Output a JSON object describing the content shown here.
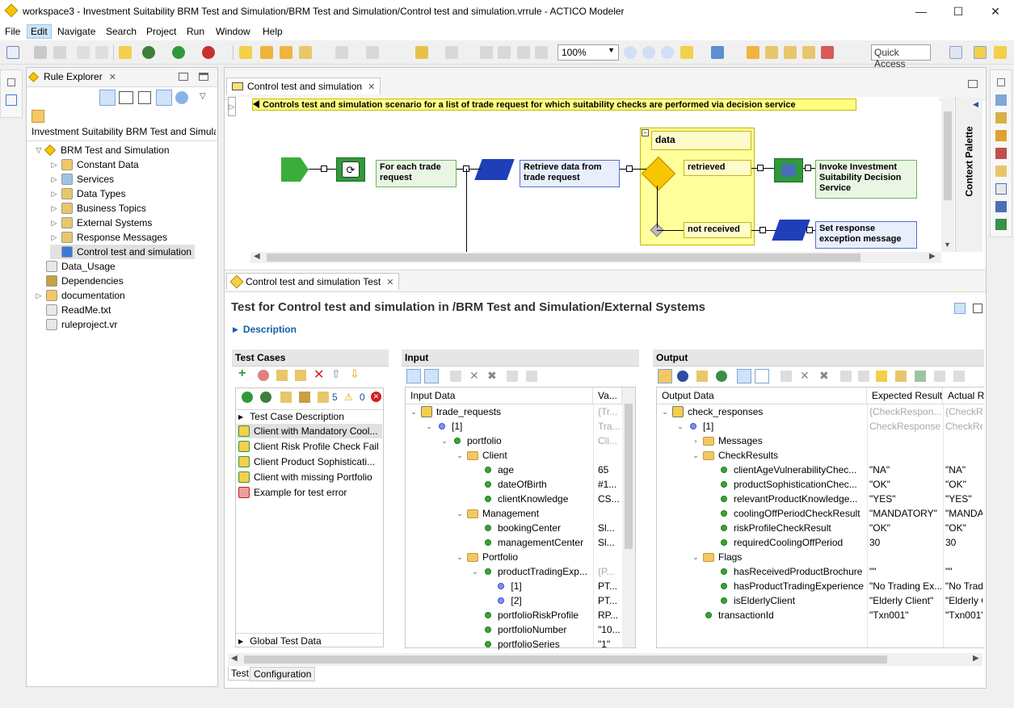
{
  "window": {
    "title": "workspace3 - Investment Suitability BRM Test and Simulation/BRM Test and Simulation/Control test and simulation.vrrule - ACTICO Modeler",
    "controls": [
      "—",
      "☐",
      "✕"
    ]
  },
  "menu": [
    "File",
    "Edit",
    "Navigate",
    "Search",
    "Project",
    "Run",
    "Window",
    "Help"
  ],
  "toolbar": {
    "zoom": "100%",
    "quick_access": "Quick Access"
  },
  "explorer": {
    "tab": "Rule Explorer",
    "project": "Investment Suitability BRM Test and Simula",
    "items": [
      {
        "label": "BRM Test and Simulation",
        "level": 0
      },
      {
        "label": "Constant Data",
        "level": 1
      },
      {
        "label": "Services",
        "level": 1
      },
      {
        "label": "Data Types",
        "level": 1
      },
      {
        "label": "Business Topics",
        "level": 1
      },
      {
        "label": "External Systems",
        "level": 1
      },
      {
        "label": "Response Messages",
        "level": 1
      },
      {
        "label": "Control test and simulation",
        "level": 1
      },
      {
        "label": "Data_Usage",
        "level": 0
      },
      {
        "label": "Dependencies",
        "level": 0
      },
      {
        "label": "documentation",
        "level": 0
      },
      {
        "label": "ReadMe.txt",
        "level": 0
      },
      {
        "label": "ruleproject.vr",
        "level": 0
      }
    ]
  },
  "editor": {
    "tab": "Control test and simulation",
    "banner": "Controls test and simulation scenario for a list of trade request for which suitability checks are performed via decision service",
    "nodes": {
      "loop": "For each trade request",
      "retrieve": "Retrieve data from trade request",
      "data": "data",
      "retrieved": "retrieved",
      "not_received": "not received",
      "invoke": "Invoke Investment Suitability Decision Service",
      "set_response": "Set response exception message"
    },
    "palette": "Context Palette"
  },
  "test": {
    "tab": "Control test and simulation Test",
    "heading": "Test for Control test and simulation in /BRM Test and Simulation/External Systems",
    "description": "Description",
    "test_cases": {
      "header": "Test Cases",
      "pass_count": "5",
      "warn_count": "0",
      "col": "Test Case Description",
      "items": [
        "Client with Mandatory Cool...",
        "Client Risk Profile Check Fail",
        "Client Product Sophisticati...",
        "Client with missing Portfolio",
        "Example for test error"
      ],
      "global": "Global Test Data"
    },
    "input": {
      "header": "Input",
      "col1": "Input Data",
      "col2": "Va...",
      "rows": [
        {
          "label": "trade_requests",
          "value": "{Tr...",
          "indent": 0,
          "gray": true
        },
        {
          "label": "[1]",
          "value": "Tra...",
          "indent": 1,
          "gray": true
        },
        {
          "label": "portfolio",
          "value": "Cli...",
          "indent": 2,
          "gray": true
        },
        {
          "label": "Client",
          "value": "",
          "indent": 3
        },
        {
          "label": "age",
          "value": "65",
          "indent": 4
        },
        {
          "label": "dateOfBirth",
          "value": "#1...",
          "indent": 4
        },
        {
          "label": "clientKnowledge",
          "value": "CS...",
          "indent": 4
        },
        {
          "label": "Management",
          "value": "",
          "indent": 3
        },
        {
          "label": "bookingCenter",
          "value": "Sl...",
          "indent": 4
        },
        {
          "label": "managementCenter",
          "value": "Sl...",
          "indent": 4
        },
        {
          "label": "Portfolio",
          "value": "",
          "indent": 3
        },
        {
          "label": "productTradingExp...",
          "value": "{P...",
          "indent": 4,
          "gray": true
        },
        {
          "label": "[1]",
          "value": "PT...",
          "indent": 5
        },
        {
          "label": "[2]",
          "value": "PT...",
          "indent": 5
        },
        {
          "label": "portfolioRiskProfile",
          "value": "RP...",
          "indent": 4
        },
        {
          "label": "portfolioNumber",
          "value": "\"10...",
          "indent": 4
        },
        {
          "label": "portfolioSeries",
          "value": "\"1\"",
          "indent": 4
        }
      ]
    },
    "output": {
      "header": "Output",
      "col1": "Output Data",
      "col2": "Expected Result",
      "col3": "Actual R",
      "rows": [
        {
          "label": "check_responses",
          "expected": "{CheckRespon...",
          "actual": "{CheckRe",
          "indent": 0,
          "gray": true
        },
        {
          "label": "[1]",
          "expected": "CheckResponse",
          "actual": "CheckRe",
          "indent": 1,
          "gray": true
        },
        {
          "label": "Messages",
          "expected": "",
          "actual": "",
          "indent": 2
        },
        {
          "label": "CheckResults",
          "expected": "",
          "actual": "",
          "indent": 2
        },
        {
          "label": "clientAgeVulnerabilityChec...",
          "expected": "\"NA\"",
          "actual": "\"NA\"",
          "indent": 3
        },
        {
          "label": "productSophisticationChec...",
          "expected": "\"OK\"",
          "actual": "\"OK\"",
          "indent": 3
        },
        {
          "label": "relevantProductKnowledge...",
          "expected": "\"YES\"",
          "actual": "\"YES\"",
          "indent": 3
        },
        {
          "label": "coolingOffPeriodCheckResult",
          "expected": "\"MANDATORY\"",
          "actual": "\"MANDA",
          "indent": 3
        },
        {
          "label": "riskProfileCheckResult",
          "expected": "\"OK\"",
          "actual": "\"OK\"",
          "indent": 3
        },
        {
          "label": "requiredCoolingOffPeriod",
          "expected": "30",
          "actual": "30",
          "indent": 3
        },
        {
          "label": "Flags",
          "expected": "",
          "actual": "",
          "indent": 2
        },
        {
          "label": "hasReceivedProductBrochure",
          "expected": "\"\"",
          "actual": "\"\"",
          "indent": 3
        },
        {
          "label": "hasProductTradingExperience",
          "expected": "\"No Trading Ex...",
          "actual": "\"No Trad",
          "indent": 3
        },
        {
          "label": "isElderlyClient",
          "expected": "\"Elderly Client\"",
          "actual": "\"Elderly C",
          "indent": 3
        },
        {
          "label": "transactionId",
          "expected": "\"Txn001\"",
          "actual": "\"Txn001\"",
          "indent": 2
        }
      ]
    },
    "bottom_tabs": [
      "Test",
      "Configuration"
    ]
  }
}
